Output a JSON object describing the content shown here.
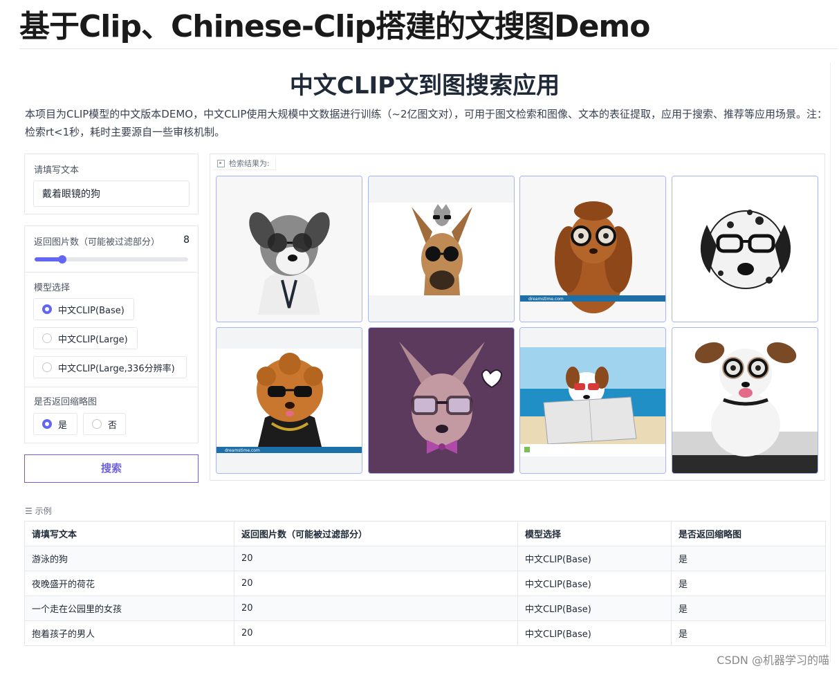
{
  "blog": {
    "title": "基于Clip、Chinese-Clip搭建的文搜图Demo"
  },
  "app": {
    "title": "中文CLIP文到图搜索应用",
    "description": "本项目为CLIP模型的中文版本DEMO，中文CLIP使用大规模中文数据进行训练（~2亿图文对），可用于图文检索和图像、文本的表征提取，应用于搜索、推荐等应用场景。注：检索rt<1秒，耗时主要源自一些审核机制。"
  },
  "form": {
    "text_label": "请填写文本",
    "text_value": "戴着眼镜的狗",
    "count_label": "返回图片数（可能被过滤部分）",
    "count_value": "8",
    "count_fraction": 0.18,
    "model_label": "模型选择",
    "model_options": [
      "中文CLIP(Base)",
      "中文CLIP(Large)",
      "中文CLIP(Large,336分辨率)"
    ],
    "thumb_label": "是否返回缩略图",
    "thumb_options": [
      "是",
      "否"
    ],
    "search_label": "搜索"
  },
  "gallery": {
    "label": "检索结果为:",
    "items": [
      "dog-1",
      "dog-2",
      "dog-3",
      "dog-4",
      "dog-5",
      "dog-6",
      "dog-7",
      "dog-8"
    ]
  },
  "examples": {
    "label": "示例",
    "headers": [
      "请填写文本",
      "返回图片数（可能被过滤部分）",
      "模型选择",
      "是否返回缩略图"
    ],
    "rows": [
      [
        "游泳的狗",
        "20",
        "中文CLIP(Base)",
        "是"
      ],
      [
        "夜晚盛开的荷花",
        "20",
        "中文CLIP(Base)",
        "是"
      ],
      [
        "一个走在公园里的女孩",
        "20",
        "中文CLIP(Base)",
        "是"
      ],
      [
        "抱着孩子的男人",
        "20",
        "中文CLIP(Base)",
        "是"
      ]
    ]
  },
  "watermark": "CSDN @机器学习的喵",
  "colors": {
    "accent": "#6366f1",
    "border": "#e5e7eb",
    "thumb_border": "#a5b4fc"
  }
}
